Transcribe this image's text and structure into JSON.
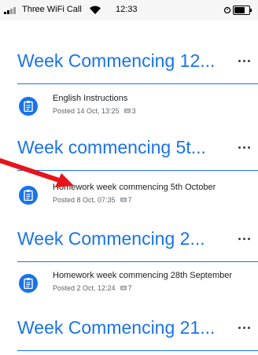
{
  "status_bar": {
    "carrier": "Three WiFi Call",
    "time": "12:33"
  },
  "topics": [
    {
      "title": "Week Commencing 12...",
      "items": [
        {
          "title": "English Instructions",
          "posted": "Posted 14 Oct, 13:25",
          "comments": "3"
        }
      ]
    },
    {
      "title": "Week commencing 5t...",
      "items": [
        {
          "title": "Homework week commencing 5th October",
          "posted": "Posted 8 Oct, 07:35",
          "comments": "7"
        }
      ]
    },
    {
      "title": "Week Commencing 2...",
      "items": [
        {
          "title": "Homework week commencing 28th September",
          "posted": "Posted 2 Oct, 12:24",
          "comments": "7"
        }
      ]
    },
    {
      "title": "Week Commencing 21...",
      "items": []
    }
  ],
  "colors": {
    "accent": "#1a73e8",
    "annotation_arrow": "#e8141b"
  },
  "icons": {
    "assignment": "assignment-icon",
    "more": "more-horizontal-icon",
    "comment": "comment-icon"
  }
}
